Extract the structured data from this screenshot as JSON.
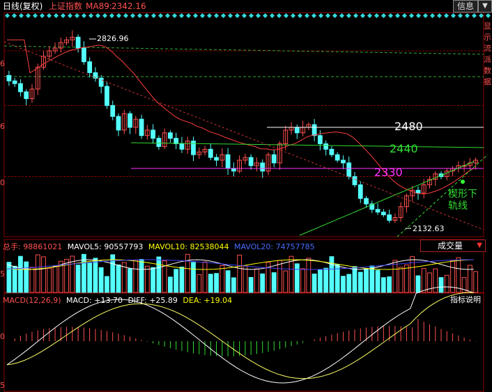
{
  "header": {
    "period_label": "日线(复权)",
    "index_name": "上证指数",
    "ma_label": "MA89:",
    "ma_value": "2342.16",
    "info_button": "信息"
  },
  "price_annotations": {
    "high_label": "2826.96",
    "low_label": "2132.63",
    "line_2480": "2480",
    "line_2440": "2440",
    "line_2330": "2330",
    "wedge_label_1": "楔形下",
    "wedge_label_2": "轨线"
  },
  "volume_header": {
    "total_label": "总手:",
    "total_value": "98861021",
    "mavol5_label": "MAVOL5:",
    "mavol5_value": "90557793",
    "mavol10_label": "MAVOL10:",
    "mavol10_value": "82538044",
    "mavol20_label": "MAVOL20:",
    "mavol20_value": "74757785",
    "dropdown_label": "成交量"
  },
  "macd_header": {
    "name": "MACD(12,26,9)",
    "macd_label": "MACD:",
    "macd_value": "+13.70",
    "diff_label": "DIFF:",
    "diff_value": "+25.89",
    "dea_label": "DEA:",
    "dea_value": "+19.04",
    "help_button": "指标说明"
  },
  "right_axis_labels": [
    "显",
    "示",
    "流",
    "派",
    "数",
    "据"
  ],
  "left_axis_labels": [
    "6",
    "6",
    "0",
    "5",
    "0",
    "5"
  ],
  "colors": {
    "up": "#ff5050",
    "down": "#54ffff",
    "ma89": "#ff4040",
    "line_2480": "#ffffff",
    "line_2440": "#33dd33",
    "line_2330": "#ff33ff",
    "mavol5": "#ffffff",
    "mavol10": "#ffff00",
    "mavol20": "#4040ff"
  },
  "chart_data": [
    {
      "type": "candlestick",
      "title": "上证指数 日线(复权)",
      "ylim": [
        2080,
        2900
      ],
      "annotations": [
        {
          "label": "2826.96",
          "value": 2826.96,
          "kind": "high"
        },
        {
          "label": "2132.63",
          "value": 2132.63,
          "kind": "low"
        }
      ],
      "horizontal_levels": [
        2480,
        2440,
        2330
      ],
      "ma89_last": 2342.16,
      "close_path": [
        2650,
        2640,
        2610,
        2585,
        2620,
        2700,
        2740,
        2760,
        2770,
        2790,
        2800,
        2810,
        2770,
        2720,
        2680,
        2660,
        2630,
        2560,
        2520,
        2470,
        2530,
        2480,
        2510,
        2450,
        2470,
        2440,
        2410,
        2460,
        2440,
        2420,
        2400,
        2430,
        2380,
        2390,
        2400,
        2370,
        2360,
        2380,
        2330,
        2320,
        2360,
        2370,
        2340,
        2350,
        2320,
        2380,
        2350,
        2420,
        2470,
        2480,
        2460,
        2480,
        2490,
        2450,
        2420,
        2400,
        2380,
        2360,
        2350,
        2300,
        2270,
        2220,
        2200,
        2180,
        2170,
        2160,
        2140,
        2150,
        2190,
        2230,
        2250,
        2240,
        2270,
        2290,
        2310,
        2300,
        2320,
        2330,
        2340,
        2340,
        2350,
        2360
      ],
      "series": [
        {
          "name": "MA89",
          "last": 2342.16
        }
      ]
    },
    {
      "type": "bar",
      "title": "成交量",
      "series": [
        {
          "name": "总手",
          "last": 98861021
        },
        {
          "name": "MAVOL5",
          "last": 90557793
        },
        {
          "name": "MAVOL10",
          "last": 82538044
        },
        {
          "name": "MAVOL20",
          "last": 74757785
        }
      ]
    },
    {
      "type": "bar",
      "title": "MACD(12,26,9)",
      "series": [
        {
          "name": "MACD",
          "last": 13.7
        },
        {
          "name": "DIFF",
          "last": 25.89
        },
        {
          "name": "DEA",
          "last": 19.04
        }
      ]
    }
  ]
}
